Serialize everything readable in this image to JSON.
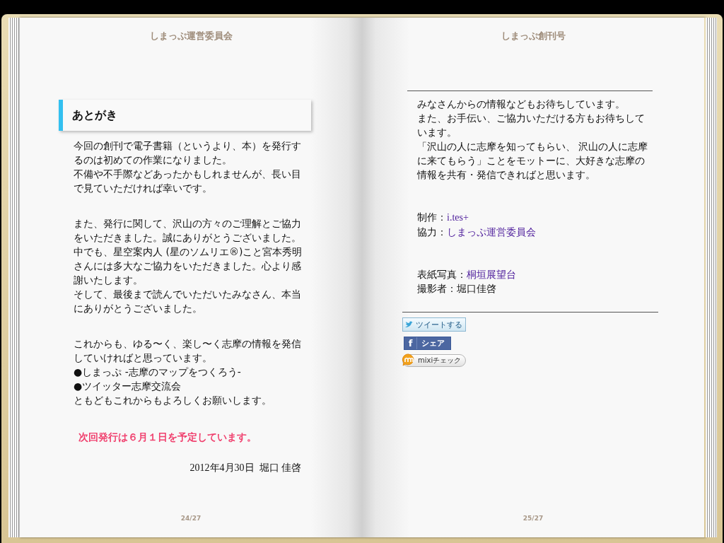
{
  "left_page": {
    "header": "しまっぷ運営委員会",
    "heading": "あとがき",
    "paragraphs": [
      [
        "今回の創刊で電子書籍（というより、本）を発行するのは初めての作業になりました。",
        "不備や不手際などあったかもしれませんが、長い目で見ていただければ幸いです。"
      ],
      [
        "また、発行に関して、沢山の方々のご理解とご協力をいただきました。誠にありがとうございました。",
        "中でも、星空案内人 (星のソムリエ®)こと宮本秀明さんには多大なご協力をいただきました。心より感謝いたします。",
        "そして、最後まで読んでいただいたみなさん、本当にありがとうございました。"
      ],
      [
        "これからも、ゆる〜く、楽し〜く志摩の情報を発信していければと思っています。",
        "●しまっぷ -志摩のマップをつくろう-",
        "●ツイッター志摩交流会",
        "ともどもこれからもよろしくお願いします。"
      ]
    ],
    "notice": "次回発行は６月１日を予定しています。",
    "signature": "2012年4月30日  堀口 佳啓",
    "page_number": "24/27"
  },
  "right_page": {
    "header": "しまっぷ創刊号",
    "paragraphs": [
      [
        "みなさんからの情報などもお待ちしています。",
        "また、お手伝い、ご協力いただける方もお待ちしています。",
        "「沢山の人に志摩を知ってもらい、 沢山の人に志摩に来てもらう」ことをモットーに、大好きな志摩の情報を共有・発信できればと思います。"
      ]
    ],
    "credits": [
      [
        {
          "label": "制作：",
          "value": "i.tes+",
          "link": true
        },
        {
          "label": "協力：",
          "value": "しまっぷ運営委員会",
          "link": true
        }
      ],
      [
        {
          "label": "表紙写真：",
          "value": "桐垣展望台",
          "link": true
        },
        {
          "label": "撮影者：",
          "value": "堀口佳啓",
          "link": false
        }
      ]
    ],
    "share_buttons": [
      {
        "kind": "twitter",
        "label": "ツイートする"
      },
      {
        "kind": "facebook",
        "icon": "f",
        "label": "シェア"
      },
      {
        "kind": "mixi",
        "label": "mixiチェック"
      }
    ],
    "page_number": "25/27"
  }
}
